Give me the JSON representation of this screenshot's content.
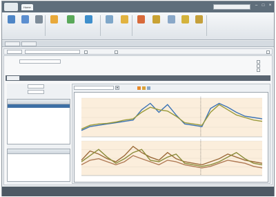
{
  "app": {
    "title_tabs": [
      "Home",
      "",
      "",
      ""
    ],
    "search_placeholder": "",
    "window_controls": [
      "minimize-icon",
      "maximize-icon",
      "close-icon"
    ]
  },
  "ribbon": {
    "buttons": [
      {
        "label": "",
        "icon": "open-folder-icon",
        "color": "#4f86c6"
      },
      {
        "label": "",
        "icon": "save-icon",
        "color": "#5c8fd0"
      },
      {
        "label": "",
        "icon": "print-icon",
        "color": "#7e8c99"
      },
      {
        "label": "",
        "icon": "export-icon",
        "color": "#e8a93a"
      },
      {
        "label": "",
        "icon": "chart-icon",
        "color": "#5aa95a"
      },
      {
        "label": "",
        "icon": "refresh-icon",
        "color": "#3e8fcc"
      },
      {
        "label": "",
        "icon": "filter-icon",
        "color": "#7fa7c9"
      },
      {
        "label": "",
        "icon": "settings-icon",
        "color": "#e2b340"
      },
      {
        "label": "",
        "icon": "report-icon",
        "color": "#d86a3a"
      },
      {
        "label": "",
        "icon": "compare-icon",
        "color": "#c9a233"
      },
      {
        "label": "",
        "icon": "grid-icon",
        "color": "#8aa8c8"
      },
      {
        "label": "",
        "icon": "help-icon",
        "color": "#d4b33c"
      },
      {
        "label": "",
        "icon": "tools-icon",
        "color": "#c5a03b"
      }
    ]
  },
  "subbar": {
    "tabs": [
      "",
      ""
    ]
  },
  "filters": {
    "field1_value": "",
    "field2_value": "",
    "check_label": "",
    "right_label": ""
  },
  "content": {
    "section_tabs": [
      "",
      "",
      "",
      "",
      "",
      "",
      "",
      ""
    ],
    "left_fields": [
      {
        "label": "",
        "value": ""
      },
      {
        "label": "",
        "value": ""
      }
    ],
    "right_fields": [
      "",
      "",
      "",
      ""
    ]
  },
  "left_panel": {
    "list_title": "",
    "items": [
      "",
      "",
      "",
      ""
    ],
    "info_title": "",
    "info_lines": [
      "",
      "",
      "",
      ""
    ]
  },
  "chart_toolbar": {
    "dropdown_value": "",
    "legend_text": ""
  },
  "chart_data": [
    {
      "type": "line",
      "x": [
        1,
        2,
        3,
        4,
        5,
        6,
        7,
        8,
        9,
        10,
        11,
        12,
        13,
        14,
        15,
        16,
        17,
        18,
        19,
        20,
        21,
        22
      ],
      "series": [
        {
          "values": [
            30,
            36,
            38,
            40,
            42,
            44,
            46,
            62,
            72,
            58,
            70,
            54,
            40,
            38,
            36,
            64,
            72,
            66,
            58,
            52,
            50,
            48
          ],
          "color": "#3b73b5"
        },
        {
          "values": [
            32,
            38,
            40,
            41,
            43,
            46,
            48,
            58,
            66,
            62,
            60,
            52,
            42,
            40,
            38,
            58,
            70,
            62,
            54,
            50,
            46,
            44
          ],
          "color": "#9a9a3a"
        }
      ],
      "ylim": [
        20,
        80
      ],
      "grid": true
    },
    {
      "type": "line",
      "x": [
        1,
        2,
        3,
        4,
        5,
        6,
        7,
        8,
        9,
        10,
        11,
        12,
        13,
        14,
        15,
        16,
        17,
        18,
        19,
        20,
        21,
        22
      ],
      "series": [
        {
          "values": [
            20,
            32,
            28,
            22,
            18,
            26,
            38,
            30,
            24,
            20,
            30,
            22,
            18,
            16,
            14,
            18,
            22,
            28,
            24,
            20,
            18,
            16
          ],
          "color": "#9c6b3a"
        },
        {
          "values": [
            18,
            26,
            34,
            24,
            16,
            22,
            30,
            34,
            20,
            18,
            24,
            28,
            16,
            14,
            12,
            14,
            18,
            24,
            30,
            22,
            16,
            14
          ],
          "color": "#8c8c3a"
        },
        {
          "values": [
            14,
            20,
            22,
            18,
            14,
            18,
            26,
            22,
            18,
            14,
            20,
            18,
            14,
            12,
            10,
            12,
            16,
            20,
            18,
            16,
            12,
            10
          ],
          "color": "#b07a55"
        }
      ],
      "ylim": [
        0,
        45
      ],
      "grid": true
    }
  ],
  "status": {
    "items": [
      "",
      ""
    ]
  }
}
